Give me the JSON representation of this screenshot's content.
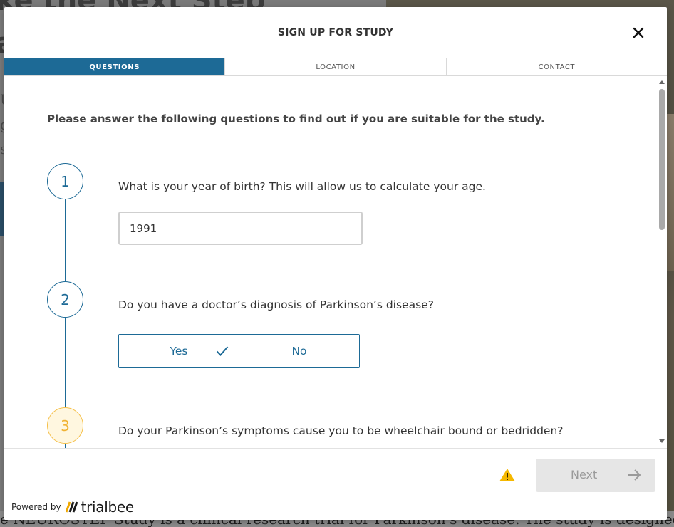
{
  "background": {
    "headline": "ke the Next Step",
    "headline_line2": "a",
    "side_glyphs": [
      "U",
      "g",
      "s"
    ],
    "footer_text": "e NEUROSTEP Study is a clinical research trial for Parkinson's disease. The study is designed to evalua"
  },
  "modal": {
    "title": "SIGN UP FOR STUDY",
    "steps": [
      {
        "label": "QUESTIONS",
        "active": true
      },
      {
        "label": "LOCATION",
        "active": false
      },
      {
        "label": "CONTACT",
        "active": false
      }
    ],
    "intro": "Please answer the following questions to find out if you are suitable for the study.",
    "questions": [
      {
        "number": "1",
        "text": "What is your year of birth? This will allow us to calculate your age.",
        "answer": "1991"
      },
      {
        "number": "2",
        "text": "Do you have a doctor’s diagnosis of Parkinson’s disease?",
        "options": [
          "Yes",
          "No"
        ],
        "selected": "Yes"
      },
      {
        "number": "3",
        "text": "Do your Parkinson’s symptoms cause you to be wheelchair bound or bedridden?"
      }
    ],
    "footer": {
      "next_label": "Next",
      "powered_by": "Powered by",
      "brand": "trialbee"
    }
  },
  "colors": {
    "accent": "#1d6a96",
    "current_step": "#f0b232",
    "warning": "#f5b800",
    "disabled_button": "#e6e6e6"
  },
  "icons": [
    "close-icon",
    "check-icon",
    "warning-icon",
    "arrow-right-icon",
    "trialbee-logo-icon",
    "scroll-up-icon",
    "scroll-down-icon"
  ]
}
